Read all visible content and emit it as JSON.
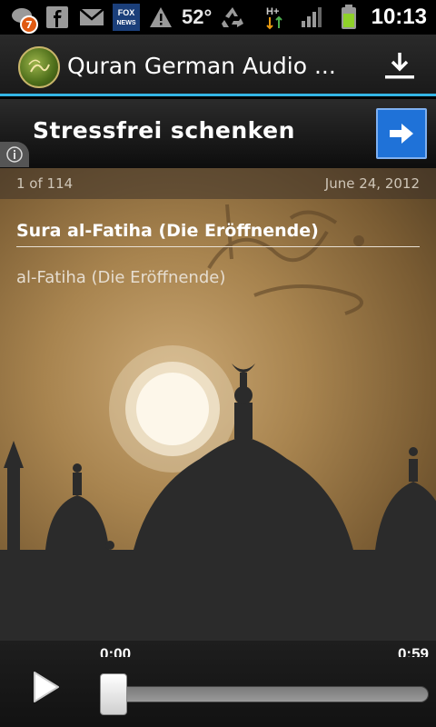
{
  "status_bar": {
    "notification_badge": "7",
    "fox_label": "FOX NEWS",
    "temperature": "52°",
    "network_type": "H+",
    "clock": "10:13"
  },
  "action_bar": {
    "title": "Quran German Audio ...",
    "logo_icon": "quran-logo-icon",
    "action_icon": "download-icon"
  },
  "ad": {
    "text": "Stressfrei schenken",
    "arrow_icon": "arrow-right-icon",
    "info_icon": "info-icon",
    "accent": "#1f72d8"
  },
  "item": {
    "position": "1 of 114",
    "date": "June 24, 2012",
    "title": "Sura al-Fatiha (Die Eröffnende)",
    "subtitle": "al-Fatiha (Die Eröffnende)"
  },
  "player": {
    "time_current": "0:00",
    "time_total": "0:59",
    "progress": 0.0,
    "play_icon": "play-icon"
  },
  "colors": {
    "accent_line": "#33b5e5",
    "background_warm": "#a8844f"
  }
}
